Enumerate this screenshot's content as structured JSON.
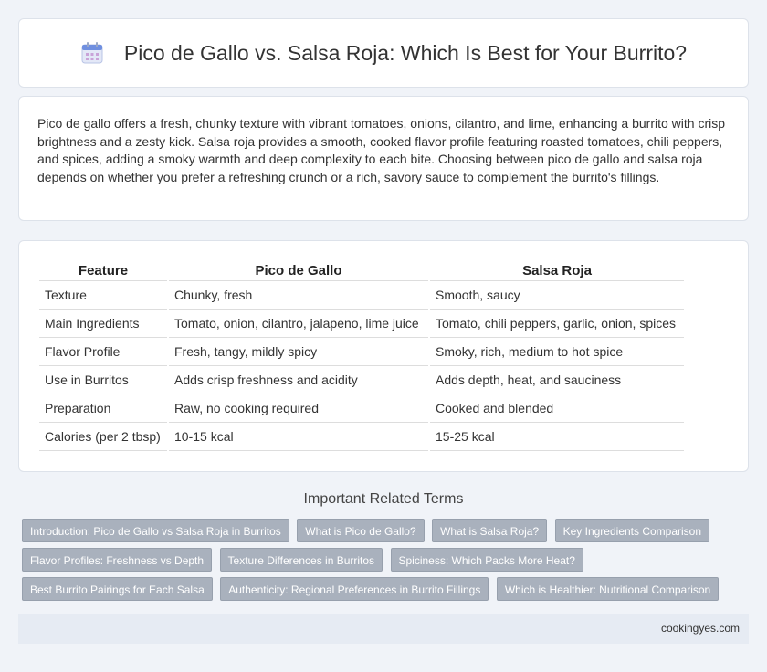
{
  "header": {
    "title": "Pico de Gallo vs. Salsa Roja: Which Is Best for Your Burrito?",
    "icon": "calendar-icon"
  },
  "intro": {
    "text": "Pico de gallo offers a fresh, chunky texture with vibrant tomatoes, onions, cilantro, and lime, enhancing a burrito with crisp brightness and a zesty kick. Salsa roja provides a smooth, cooked flavor profile featuring roasted tomatoes, chili peppers, and spices, adding a smoky warmth and deep complexity to each bite. Choosing between pico de gallo and salsa roja depends on whether you prefer a refreshing crunch or a rich, savory sauce to complement the burrito's fillings."
  },
  "table": {
    "headers": [
      "Feature",
      "Pico de Gallo",
      "Salsa Roja"
    ],
    "rows": [
      [
        "Texture",
        "Chunky, fresh",
        "Smooth, saucy"
      ],
      [
        "Main Ingredients",
        "Tomato, onion, cilantro, jalapeno, lime juice",
        "Tomato, chili peppers, garlic, onion, spices"
      ],
      [
        "Flavor Profile",
        "Fresh, tangy, mildly spicy",
        "Smoky, rich, medium to hot spice"
      ],
      [
        "Use in Burritos",
        "Adds crisp freshness and acidity",
        "Adds depth, heat, and sauciness"
      ],
      [
        "Preparation",
        "Raw, no cooking required",
        "Cooked and blended"
      ],
      [
        "Calories (per 2 tbsp)",
        "10-15 kcal",
        "15-25 kcal"
      ]
    ]
  },
  "related": {
    "title": "Important Related Terms",
    "tags": [
      "Introduction: Pico de Gallo vs Salsa Roja in Burritos",
      "What is Pico de Gallo?",
      "What is Salsa Roja?",
      "Key Ingredients Comparison",
      "Flavor Profiles: Freshness vs Depth",
      "Texture Differences in Burritos",
      "Spiciness: Which Packs More Heat?",
      "Best Burrito Pairings for Each Salsa",
      "Authenticity: Regional Preferences in Burrito Fillings",
      "Which is Healthier: Nutritional Comparison"
    ]
  },
  "footer": {
    "site": "cookingyes.com"
  },
  "colors": {
    "tag_bg": "#a9b1bd",
    "page_bg": "#f0f3f8",
    "footer_bg": "#e6ebf3"
  }
}
